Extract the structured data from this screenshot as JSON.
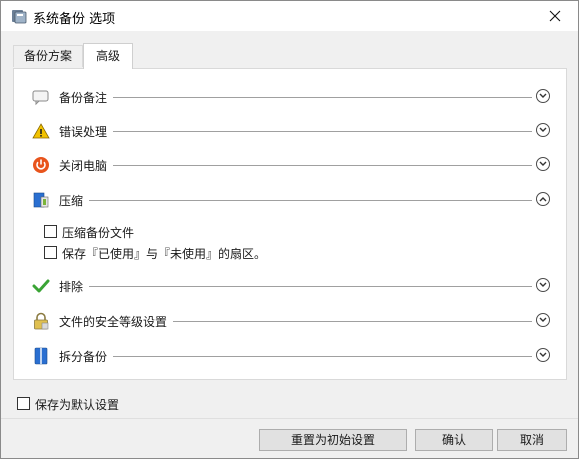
{
  "window": {
    "title": "系统备份 选项",
    "icons": {
      "app": "backup-app-icon",
      "close": "close-icon"
    }
  },
  "tabs": [
    {
      "label": "备份方案",
      "active": false
    },
    {
      "label": "高级",
      "active": true
    }
  ],
  "sections": {
    "note": {
      "label": "备份备注",
      "icon": "note-icon",
      "expanded": false
    },
    "error": {
      "label": "错误处理",
      "icon": "warning-icon",
      "expanded": false
    },
    "shutdown": {
      "label": "关闭电脑",
      "icon": "power-icon",
      "expanded": false
    },
    "compress": {
      "label": "压缩",
      "icon": "compress-icon",
      "expanded": true,
      "options": {
        "compress_file": {
          "label": "压缩备份文件",
          "checked": false
        },
        "used_sectors": {
          "label": "保存『已使用』与『未使用』的扇区。",
          "checked": false
        }
      }
    },
    "exclude": {
      "label": "排除",
      "icon": "checkmark-icon",
      "expanded": false
    },
    "security": {
      "label": "文件的安全等级设置",
      "icon": "lock-icon",
      "expanded": false
    },
    "split": {
      "label": "拆分备份",
      "icon": "split-icon",
      "expanded": false
    }
  },
  "default_setting": {
    "label": "保存为默认设置",
    "checked": false
  },
  "buttons": {
    "reset": "重置为初始设置",
    "ok": "确认",
    "cancel": "取消"
  },
  "colors": {
    "accent_red": "#e8541c",
    "warn_yellow": "#f2c200",
    "check_green": "#3aa435",
    "blue": "#2a6fd1"
  }
}
